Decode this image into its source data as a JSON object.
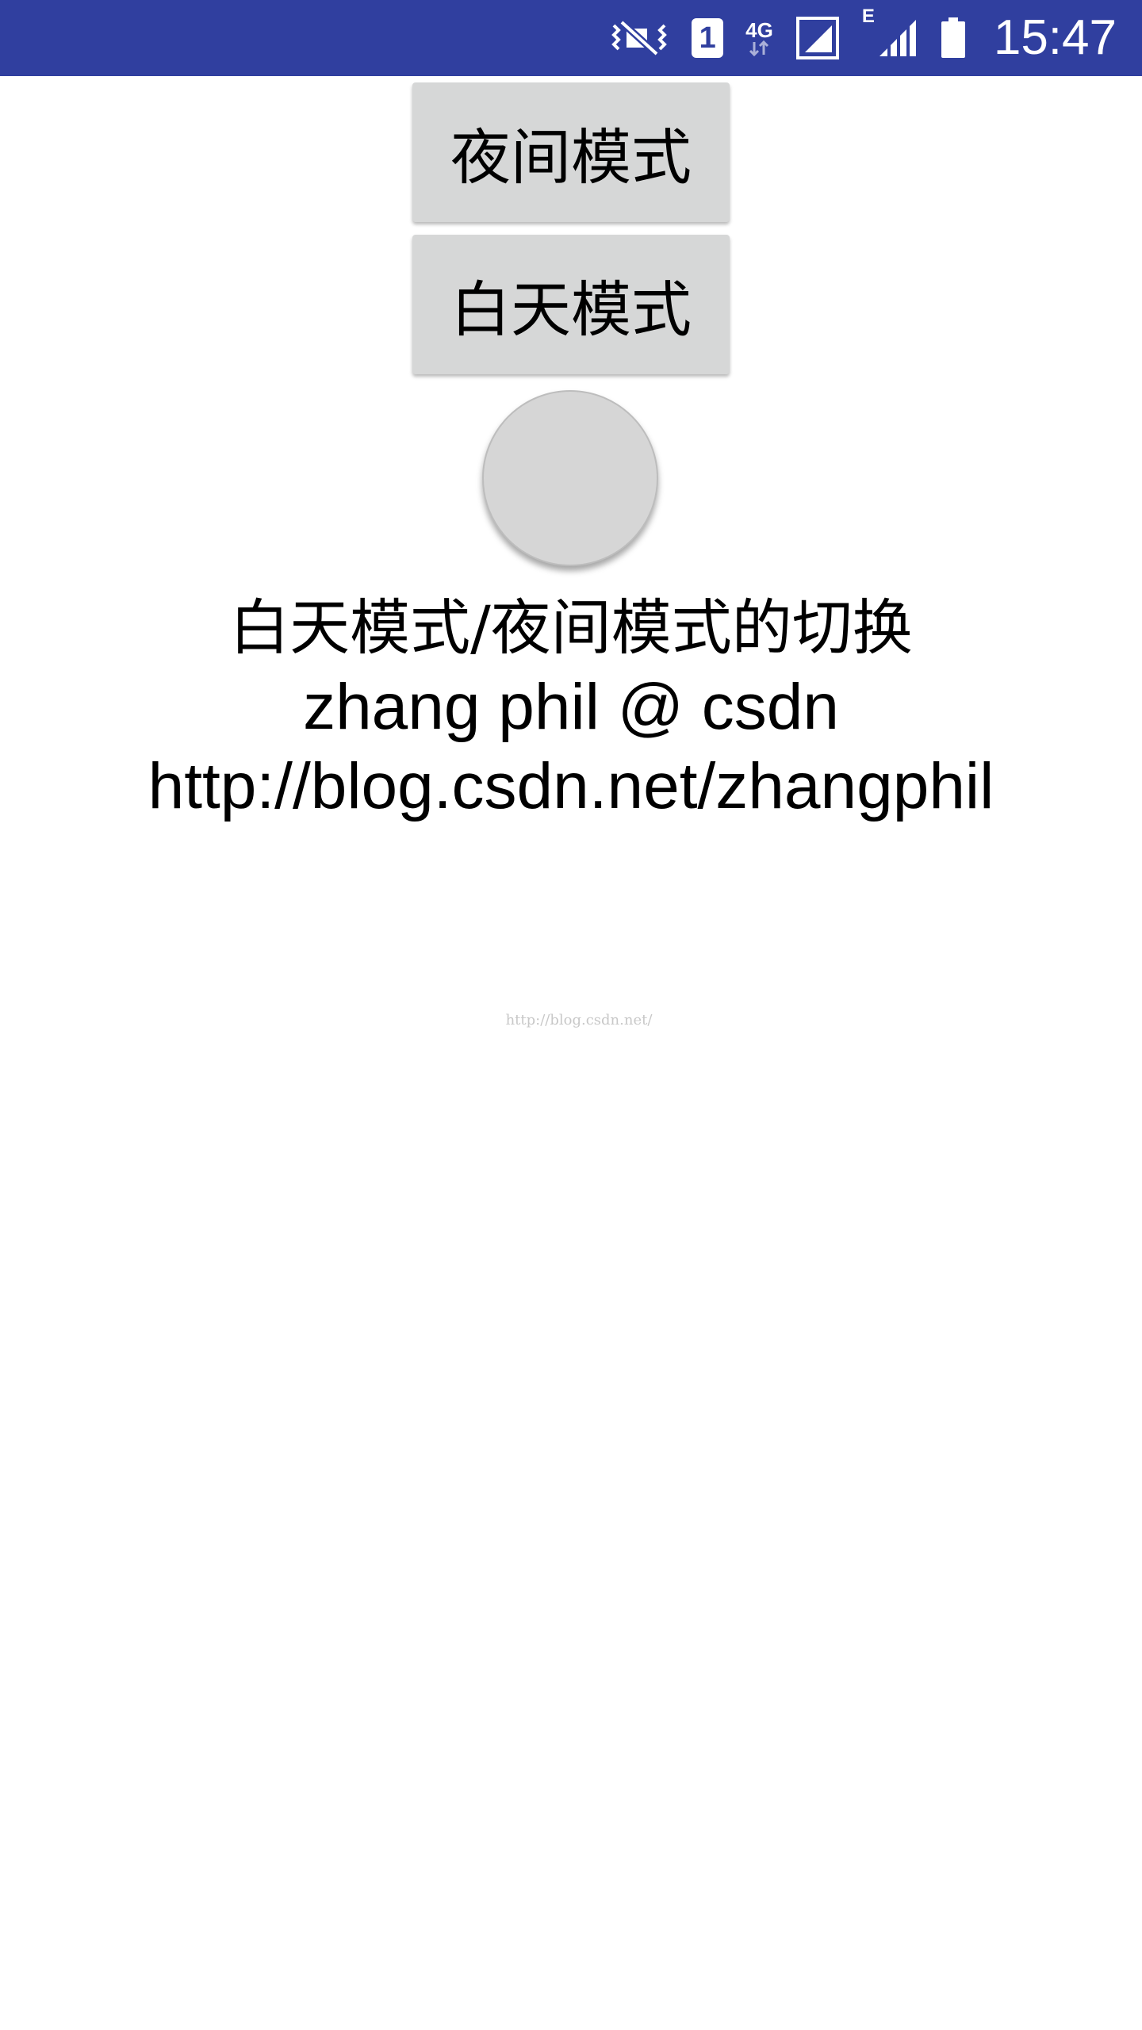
{
  "status_bar": {
    "time": "15:47",
    "sim_slot": "1",
    "network_type": "4G",
    "edge_label": "E",
    "background_color": "#303F9F",
    "icons": [
      "vibrate-mute-icon",
      "sim-1-icon",
      "4g-data-icon",
      "signal-sim1-icon",
      "edge-signal-icon",
      "battery-icon"
    ]
  },
  "buttons": {
    "night_mode_label": "夜间模式",
    "day_mode_label": "白天模式"
  },
  "info": {
    "line1": "白天模式/夜间模式的切换",
    "line2": "zhang phil @ csdn",
    "line3": "http://blog.csdn.net/zhangphil"
  },
  "watermark": "http://blog.csdn.net/"
}
